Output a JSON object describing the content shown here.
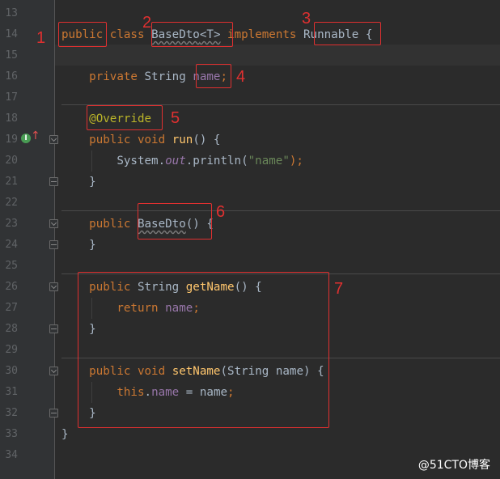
{
  "line_numbers": [
    "13",
    "14",
    "15",
    "16",
    "17",
    "18",
    "19",
    "20",
    "21",
    "22",
    "23",
    "24",
    "25",
    "26",
    "27",
    "28",
    "29",
    "30",
    "31",
    "32",
    "33",
    "34"
  ],
  "code": {
    "l14": {
      "k1": "public",
      "k2": "class",
      "cls": "BaseDto",
      "tp": "<T>",
      "k3": "implements",
      "iface": "Runnable",
      "brace": "{"
    },
    "l16": {
      "k1": "private",
      "type": "String",
      "fld": "name",
      "semi": ";"
    },
    "l18": {
      "ann": "@Override"
    },
    "l19": {
      "k1": "public",
      "k2": "void",
      "fn": "run",
      "rest": "() {"
    },
    "l20": {
      "obj": "System.",
      "out": "out",
      "call": ".println(",
      "str": "\"name\"",
      "end": ");"
    },
    "l21": {
      "t": "}"
    },
    "l23": {
      "k1": "public",
      "ctor": "BaseDto",
      "rest": "() {"
    },
    "l24": {
      "t": "}"
    },
    "l26": {
      "k1": "public",
      "type": "String",
      "fn": "getName",
      "rest": "() {"
    },
    "l27": {
      "k1": "return",
      "fld": "name",
      "semi": ";"
    },
    "l28": {
      "t": "}"
    },
    "l30": {
      "k1": "public",
      "k2": "void",
      "fn": "setName",
      "rest": "(String name) {"
    },
    "l31": {
      "k1": "this",
      "dot": ".",
      "fld": "name",
      "rest": " = name",
      "semi": ";"
    },
    "l32": {
      "t": "}"
    },
    "l33": {
      "t": "}"
    }
  },
  "gutter_icon": {
    "label": "I",
    "name": "implements-marker-icon"
  },
  "annotations": [
    "1",
    "2",
    "3",
    "4",
    "5",
    "6",
    "7"
  ],
  "watermark": "@51CTO博客",
  "colors": {
    "keyword": "#cc7832",
    "field": "#9876aa",
    "method": "#ffc66d",
    "annotation": "#bbb529",
    "string": "#6a8759",
    "default": "#a9b7c6",
    "highlight_box": "#e03030"
  }
}
